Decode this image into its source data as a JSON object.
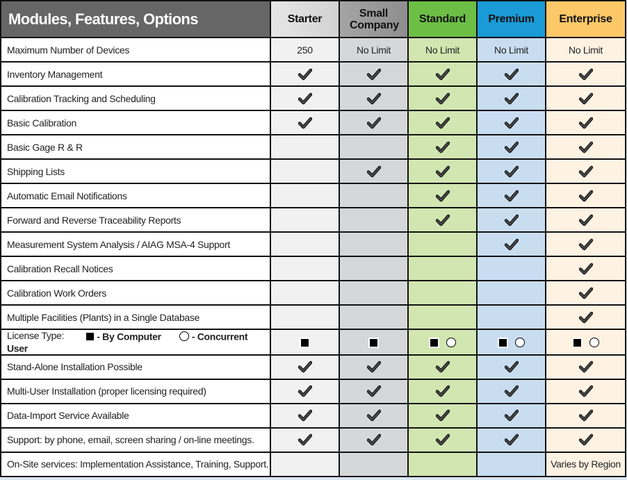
{
  "title": "Modules, Features, Options",
  "plans": [
    {
      "name": "Starter",
      "color": "#e0e0e0"
    },
    {
      "name": "Small Company",
      "color": "#9a9a9a"
    },
    {
      "name": "Standard",
      "color": "#6cbe45"
    },
    {
      "name": "Premium",
      "color": "#1a9ad6"
    },
    {
      "name": "Enterprise",
      "color": "#fdc867"
    }
  ],
  "legend": {
    "label": "License Type:",
    "by_computer_label": "- By Computer",
    "concurrent_label": "- Concurrent User",
    "by_computer_icon": "filled-square-icon",
    "concurrent_icon": "circle-icon"
  },
  "rows": [
    {
      "feature": "Maximum Number of Devices",
      "values": [
        "250",
        "No Limit",
        "No Limit",
        "No Limit",
        "No Limit"
      ]
    },
    {
      "feature": "Inventory Management",
      "values": [
        "check",
        "check",
        "check",
        "check",
        "check"
      ]
    },
    {
      "feature": "Calibration Tracking and Scheduling",
      "values": [
        "check",
        "check",
        "check",
        "check",
        "check"
      ]
    },
    {
      "feature": "Basic Calibration",
      "values": [
        "check",
        "check",
        "check",
        "check",
        "check"
      ]
    },
    {
      "feature": "Basic Gage R & R",
      "values": [
        "",
        "",
        "check",
        "check",
        "check"
      ]
    },
    {
      "feature": "Shipping Lists",
      "values": [
        "",
        "check",
        "check",
        "check",
        "check"
      ]
    },
    {
      "feature": "Automatic Email Notifications",
      "values": [
        "",
        "",
        "check",
        "check",
        "check"
      ]
    },
    {
      "feature": "Forward and Reverse Traceability Reports",
      "values": [
        "",
        "",
        "check",
        "check",
        "check"
      ]
    },
    {
      "feature": "Measurement System Analysis / AIAG MSA-4 Support",
      "values": [
        "",
        "",
        "",
        "check",
        "check"
      ]
    },
    {
      "feature": "Calibration Recall Notices",
      "values": [
        "",
        "",
        "",
        "",
        "check"
      ]
    },
    {
      "feature": "Calibration Work Orders",
      "values": [
        "",
        "",
        "",
        "",
        "check"
      ]
    },
    {
      "feature": "Multiple Facilities (Plants) in a Single Database",
      "values": [
        "",
        "",
        "",
        "",
        "check"
      ]
    },
    {
      "feature": "__license__",
      "values": [
        "square",
        "square",
        "square+circle",
        "square+circle",
        "square+circle"
      ]
    },
    {
      "feature": "Stand-Alone Installation Possible",
      "values": [
        "check",
        "check",
        "check",
        "check",
        "check"
      ]
    },
    {
      "feature": "Multi-User Installation (proper licensing required)",
      "values": [
        "check",
        "check",
        "check",
        "check",
        "check"
      ]
    },
    {
      "feature": "Data-Import Service Available",
      "values": [
        "check",
        "check",
        "check",
        "check",
        "check"
      ]
    },
    {
      "feature": "Support: by phone, email, screen sharing / on-line meetings.",
      "values": [
        "check",
        "check",
        "check",
        "check",
        "check"
      ]
    },
    {
      "feature": "On-Site services: Implementation Assistance, Training, Support.",
      "values": [
        "",
        "",
        "",
        "",
        "Varies by Region"
      ]
    }
  ]
}
